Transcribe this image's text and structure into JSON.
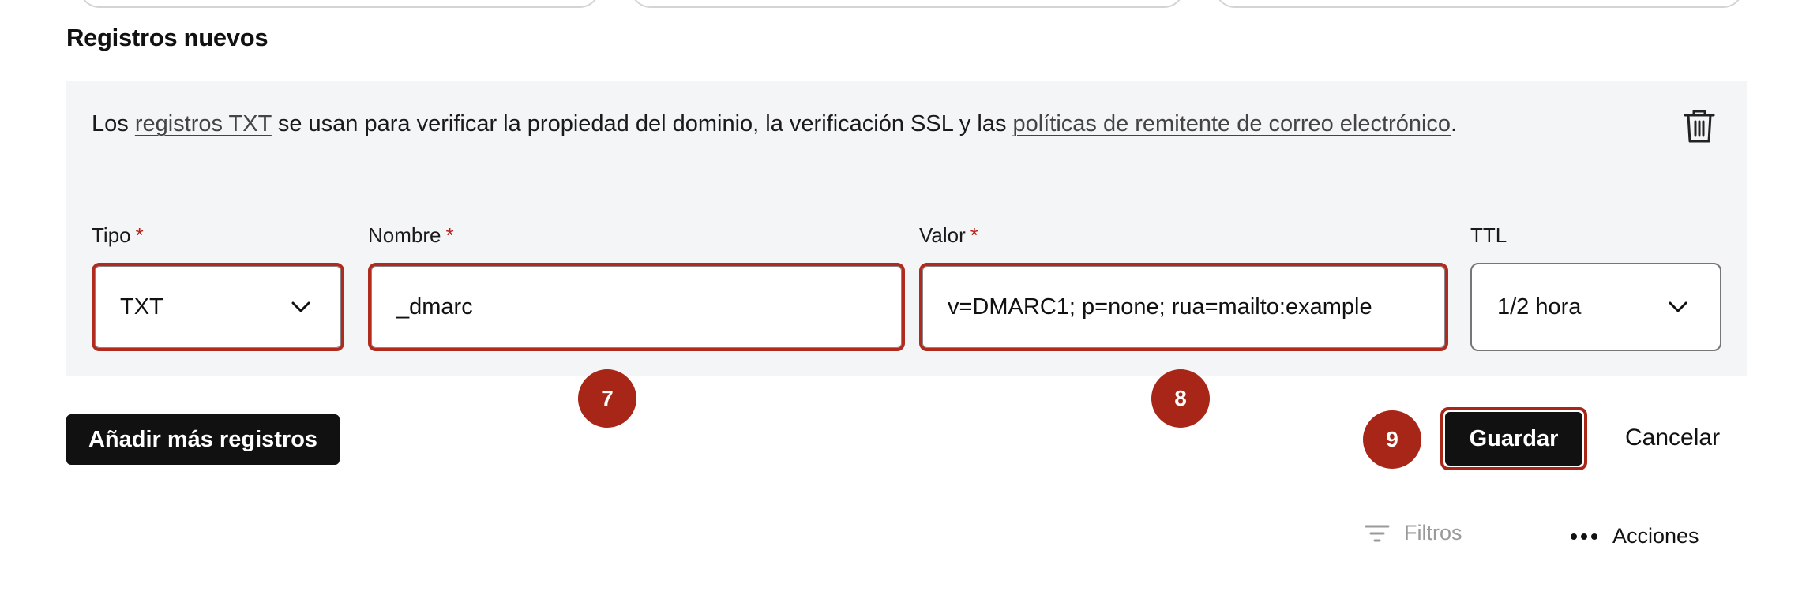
{
  "section": {
    "title": "Registros nuevos"
  },
  "info": {
    "prefix": "Los ",
    "link1": "registros TXT",
    "middle": " se usan para verificar la propiedad del dominio, la verificación SSL y las ",
    "link2": "políticas de remitente de correo electrónico",
    "suffix": "."
  },
  "fields": {
    "type": {
      "label": "Tipo",
      "required_mark": "*",
      "value": "TXT"
    },
    "name": {
      "label": "Nombre",
      "required_mark": "*",
      "value": "_dmarc"
    },
    "value": {
      "label": "Valor",
      "required_mark": "*",
      "value": "v=DMARC1; p=none; rua=mailto:example"
    },
    "ttl": {
      "label": "TTL",
      "value": "1/2 hora"
    }
  },
  "badges": {
    "b7": "7",
    "b8": "8",
    "b9": "9"
  },
  "buttons": {
    "add_more": "Añadir más registros",
    "save": "Guardar",
    "cancel": "Cancelar"
  },
  "toolbar": {
    "filters": "Filtros",
    "actions": "Acciones"
  },
  "colors": {
    "accent": "#a82618",
    "panel_bg": "#f4f5f7",
    "button_dark": "#111111"
  }
}
